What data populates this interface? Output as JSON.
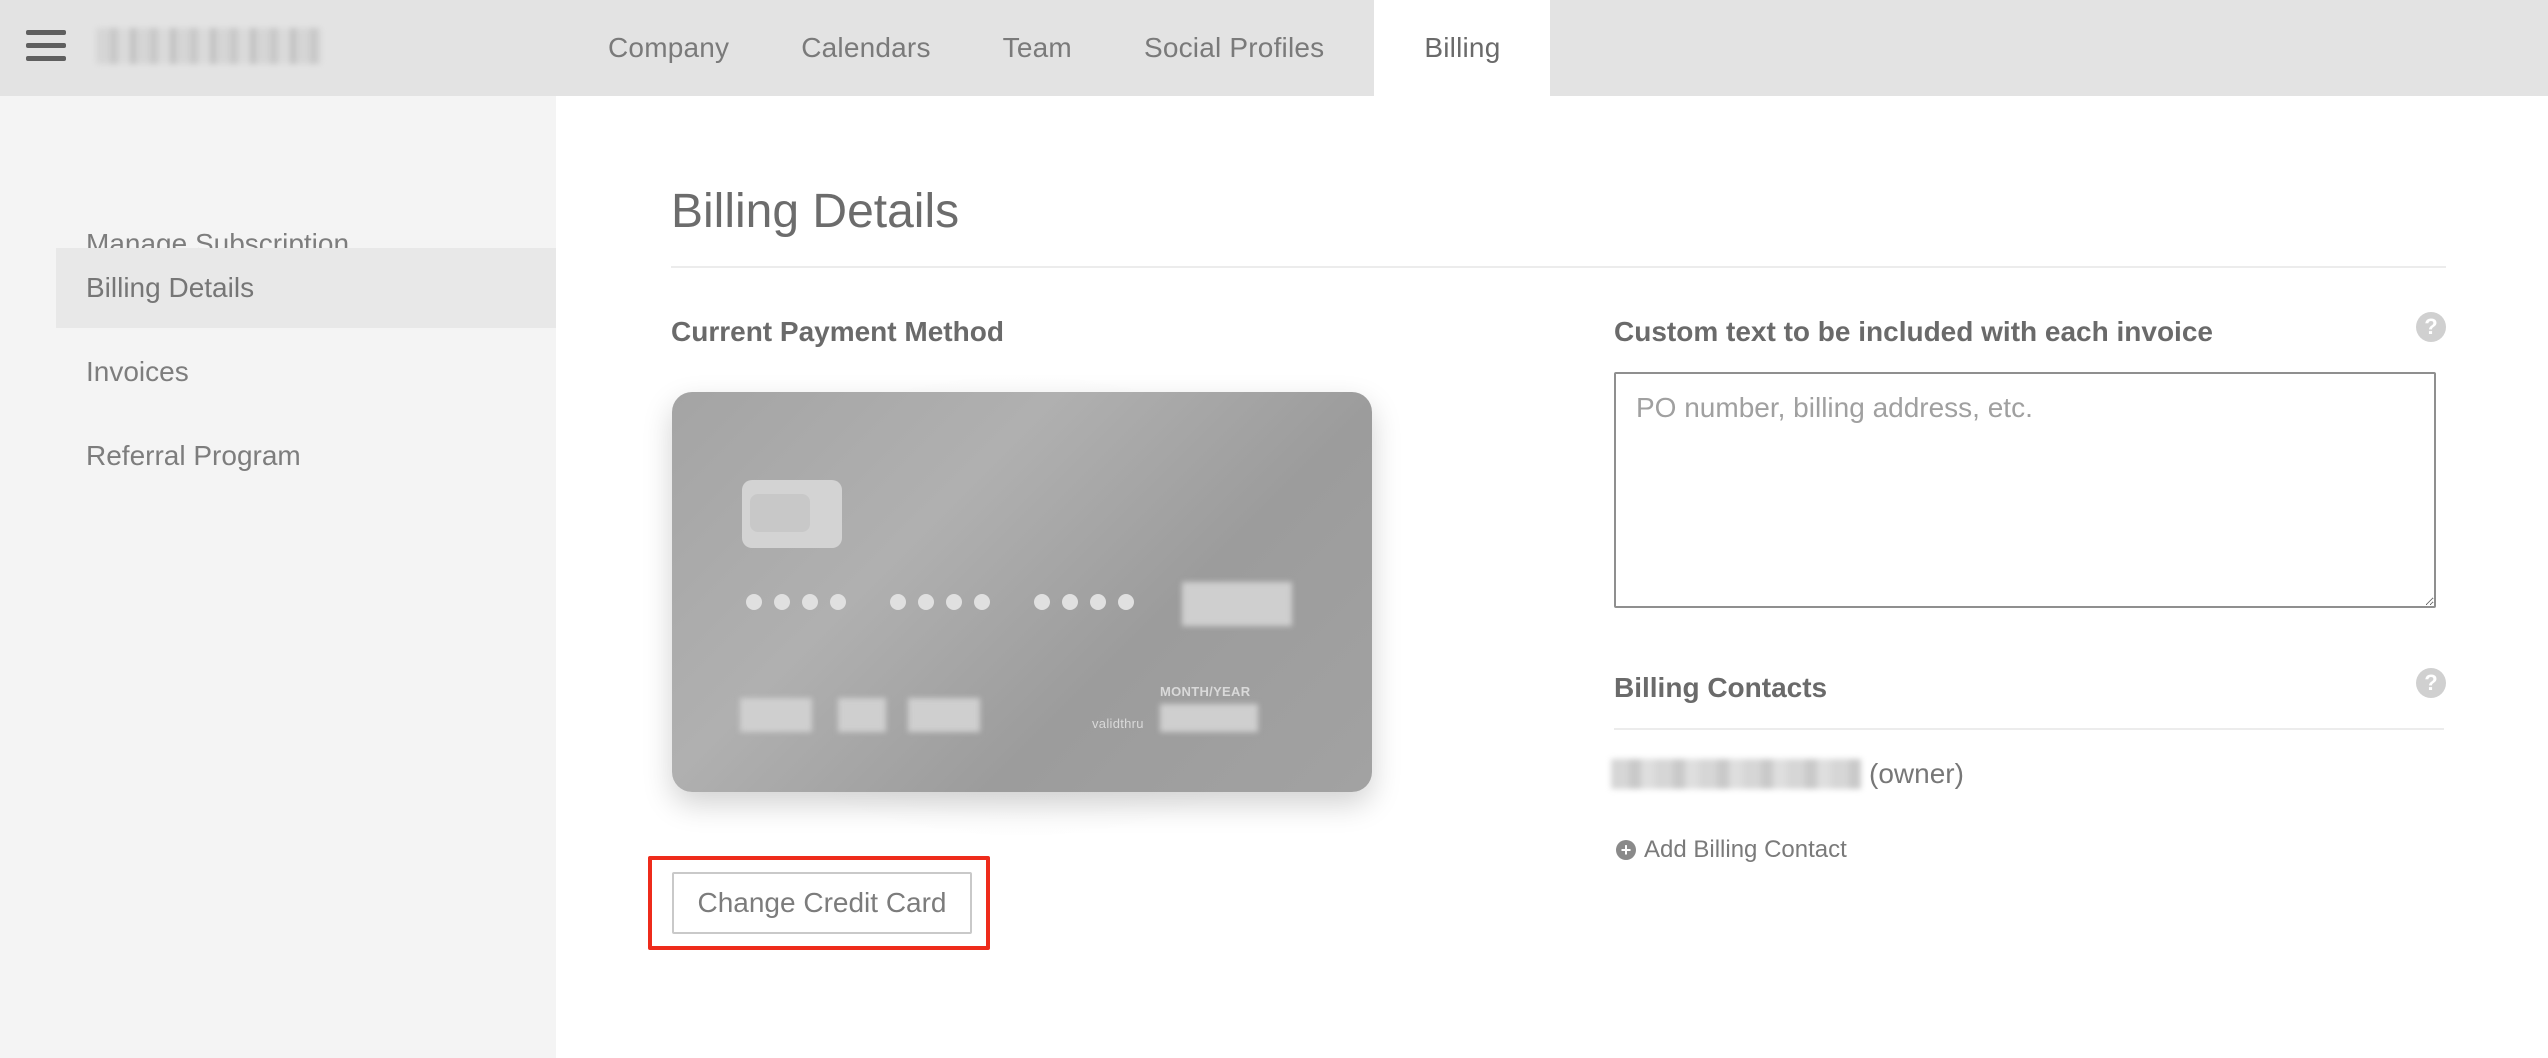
{
  "header": {
    "menu_icon": "hamburger-icon",
    "tabs": [
      {
        "label": "Company"
      },
      {
        "label": "Calendars"
      },
      {
        "label": "Team"
      },
      {
        "label": "Social Profiles"
      },
      {
        "label": "Billing",
        "active": true
      }
    ]
  },
  "sidebar": {
    "items": [
      {
        "label": "Manage Subscription"
      },
      {
        "label": "Billing Details",
        "active": true
      },
      {
        "label": "Invoices"
      },
      {
        "label": "Referral Program"
      }
    ]
  },
  "main": {
    "title": "Billing Details",
    "payment": {
      "label": "Current Payment Method",
      "card": {
        "expiry_label": "MONTH/YEAR",
        "valid_label": "validthru"
      },
      "change_button": "Change Credit Card"
    },
    "invoice_text": {
      "label": "Custom text to be included with each invoice",
      "placeholder": "PO number, billing address, etc.",
      "help_icon": "question-icon"
    },
    "contacts": {
      "label": "Billing Contacts",
      "owner_suffix": "(owner)",
      "add_label": "Add Billing Contact",
      "help_icon": "question-icon"
    }
  },
  "colors": {
    "highlight_border": "#ee2b1b",
    "topbar_bg": "#e3e3e3",
    "sidebar_bg": "#f4f4f4"
  }
}
